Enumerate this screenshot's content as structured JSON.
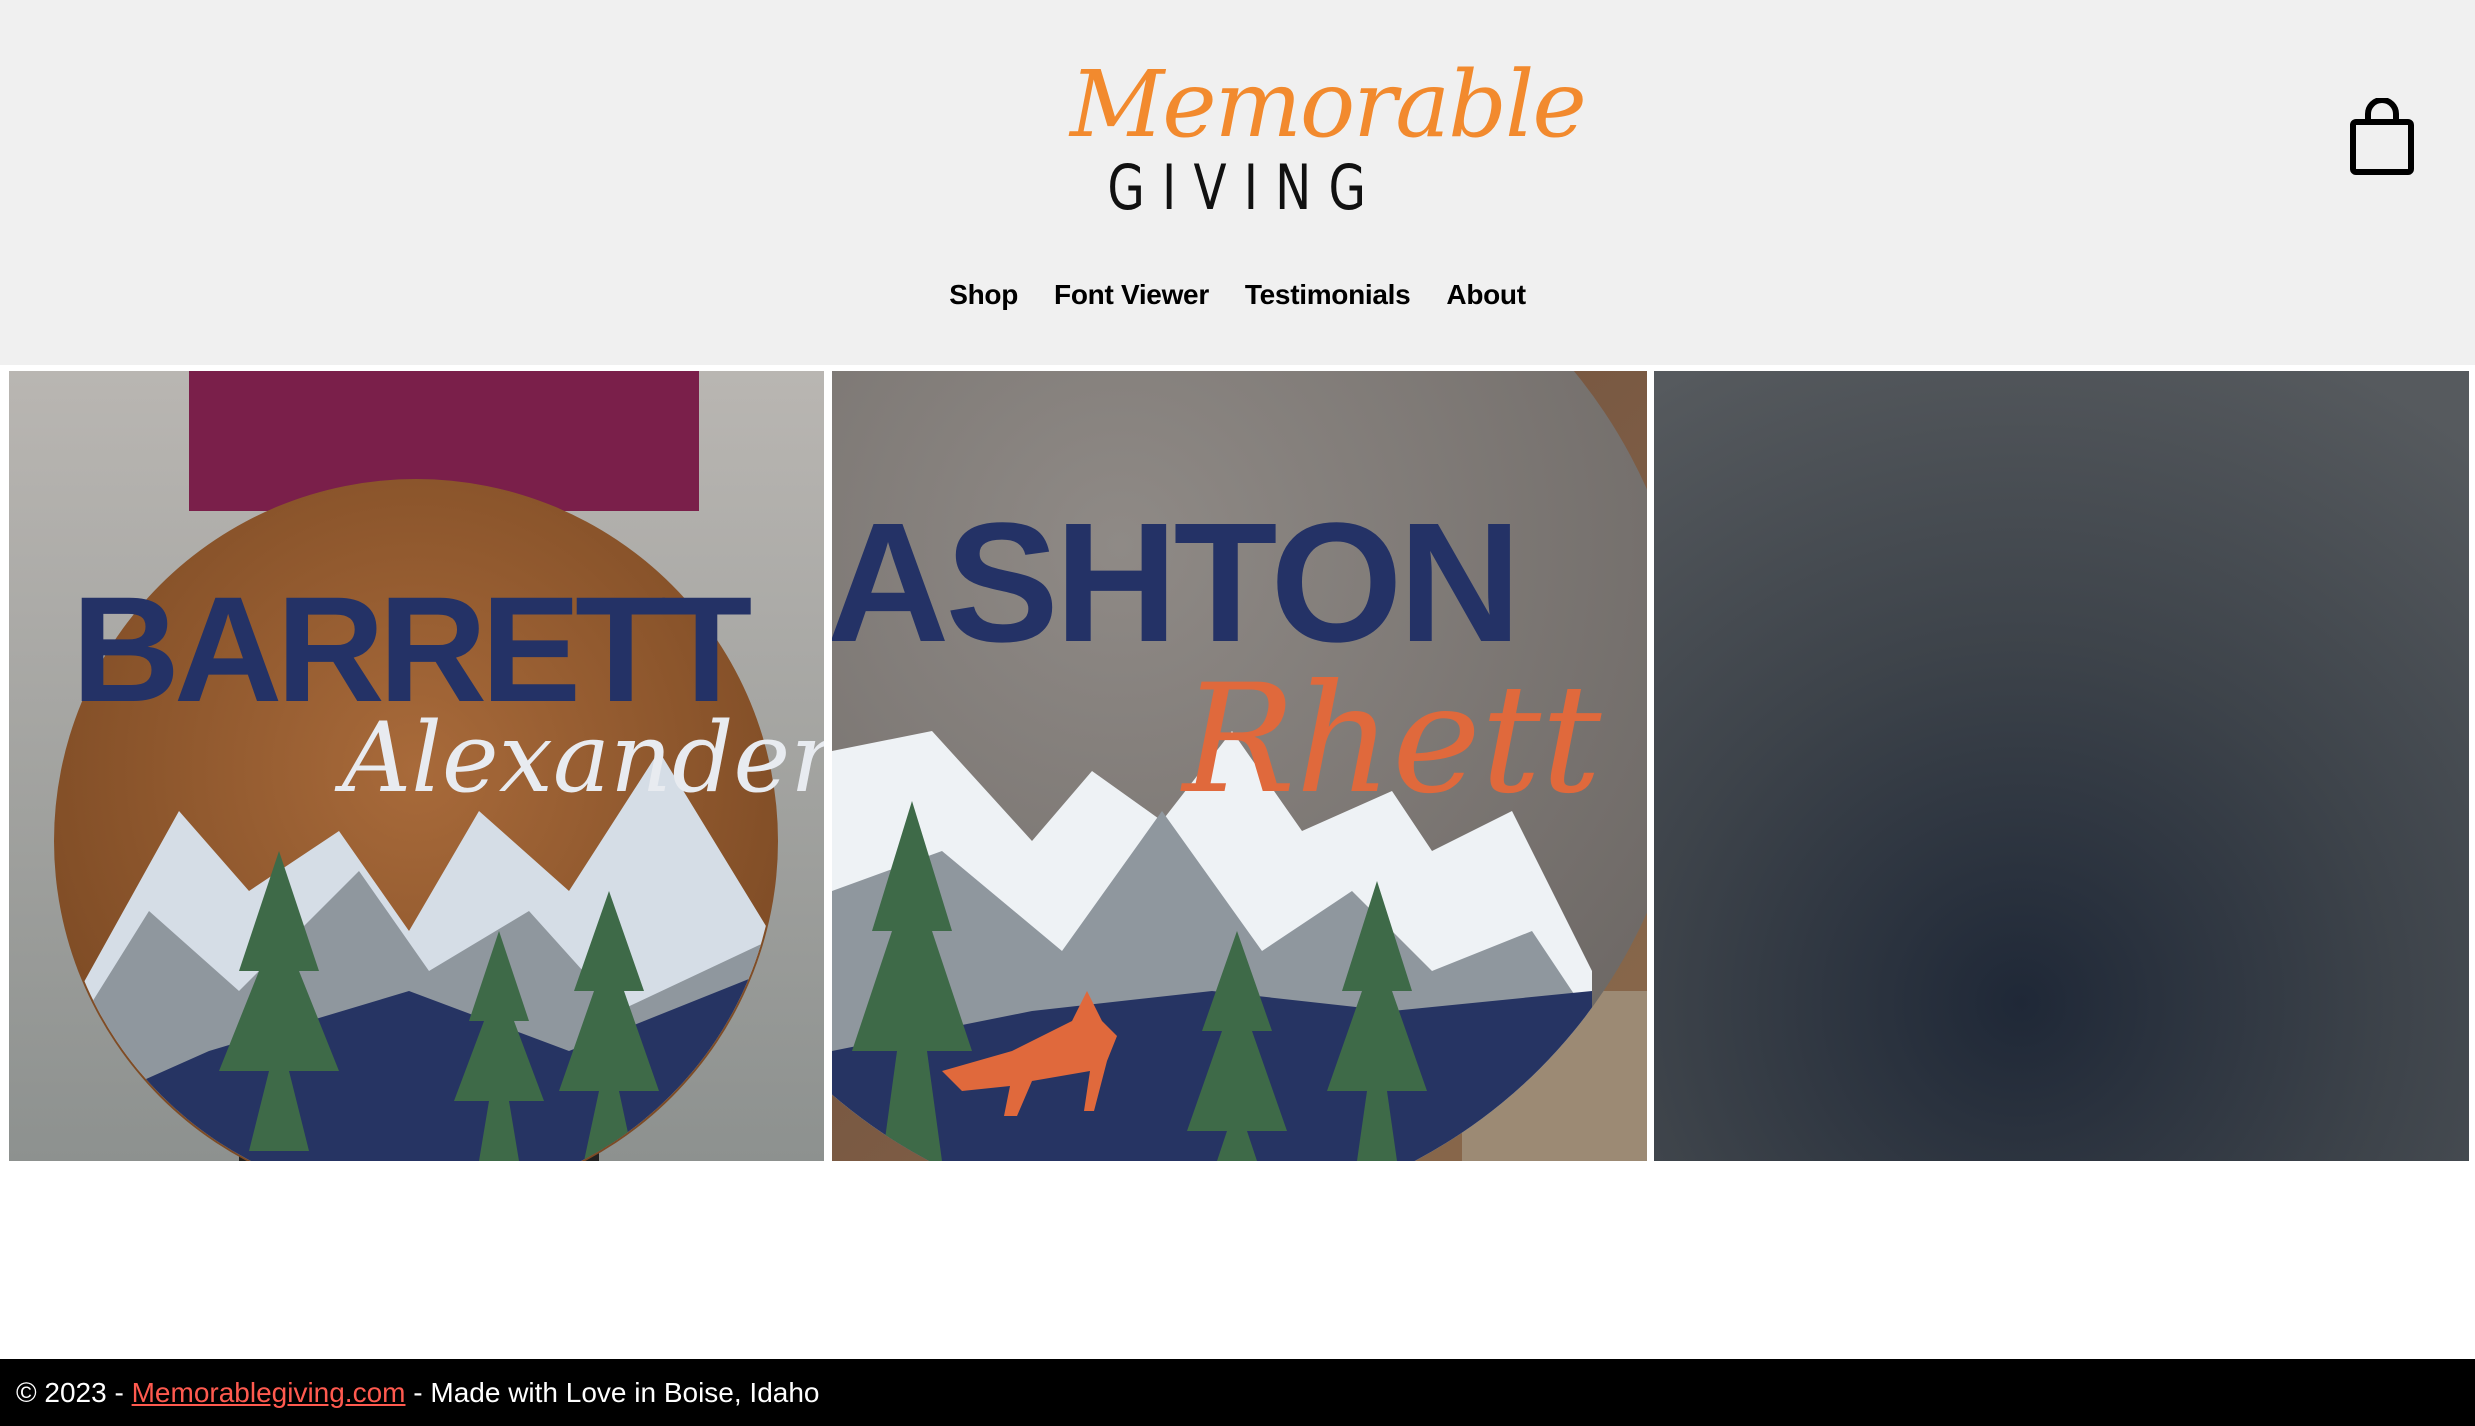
{
  "header": {
    "logo": {
      "script_text": "Memorable",
      "word_text": "GIVING"
    },
    "cart_icon": "shopping-bag-icon"
  },
  "nav": {
    "items": [
      {
        "label": "Shop"
      },
      {
        "label": "Font Viewer"
      },
      {
        "label": "Testimonials"
      },
      {
        "label": "About"
      }
    ]
  },
  "gallery": {
    "tiles": [
      {
        "line1": "BARRETT",
        "line2": "Alexander"
      },
      {
        "line1": "ASHTON",
        "line2": "Rhett"
      },
      {
        "line1": "",
        "line2": ""
      }
    ]
  },
  "footer": {
    "prefix": "© 2023 - ",
    "link": "Memorablegiving.com",
    "suffix": " - Made with Love in Boise, Idaho"
  },
  "colors": {
    "header_bg": "#f0f0f0",
    "logo_orange": "#f28a2e",
    "footer_bg": "#000000",
    "footer_link": "#ff5a4f"
  }
}
